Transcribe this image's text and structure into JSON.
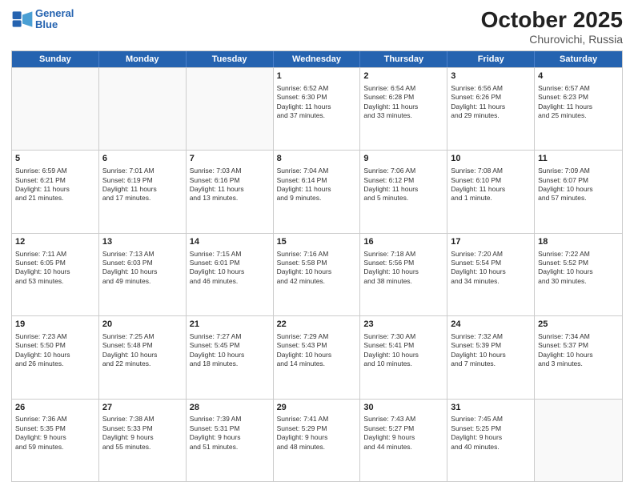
{
  "header": {
    "logo_line1": "General",
    "logo_line2": "Blue",
    "month": "October 2025",
    "location": "Churovichi, Russia"
  },
  "weekdays": [
    "Sunday",
    "Monday",
    "Tuesday",
    "Wednesday",
    "Thursday",
    "Friday",
    "Saturday"
  ],
  "rows": [
    [
      {
        "day": "",
        "text": ""
      },
      {
        "day": "",
        "text": ""
      },
      {
        "day": "",
        "text": ""
      },
      {
        "day": "1",
        "text": "Sunrise: 6:52 AM\nSunset: 6:30 PM\nDaylight: 11 hours\nand 37 minutes."
      },
      {
        "day": "2",
        "text": "Sunrise: 6:54 AM\nSunset: 6:28 PM\nDaylight: 11 hours\nand 33 minutes."
      },
      {
        "day": "3",
        "text": "Sunrise: 6:56 AM\nSunset: 6:26 PM\nDaylight: 11 hours\nand 29 minutes."
      },
      {
        "day": "4",
        "text": "Sunrise: 6:57 AM\nSunset: 6:23 PM\nDaylight: 11 hours\nand 25 minutes."
      }
    ],
    [
      {
        "day": "5",
        "text": "Sunrise: 6:59 AM\nSunset: 6:21 PM\nDaylight: 11 hours\nand 21 minutes."
      },
      {
        "day": "6",
        "text": "Sunrise: 7:01 AM\nSunset: 6:19 PM\nDaylight: 11 hours\nand 17 minutes."
      },
      {
        "day": "7",
        "text": "Sunrise: 7:03 AM\nSunset: 6:16 PM\nDaylight: 11 hours\nand 13 minutes."
      },
      {
        "day": "8",
        "text": "Sunrise: 7:04 AM\nSunset: 6:14 PM\nDaylight: 11 hours\nand 9 minutes."
      },
      {
        "day": "9",
        "text": "Sunrise: 7:06 AM\nSunset: 6:12 PM\nDaylight: 11 hours\nand 5 minutes."
      },
      {
        "day": "10",
        "text": "Sunrise: 7:08 AM\nSunset: 6:10 PM\nDaylight: 11 hours\nand 1 minute."
      },
      {
        "day": "11",
        "text": "Sunrise: 7:09 AM\nSunset: 6:07 PM\nDaylight: 10 hours\nand 57 minutes."
      }
    ],
    [
      {
        "day": "12",
        "text": "Sunrise: 7:11 AM\nSunset: 6:05 PM\nDaylight: 10 hours\nand 53 minutes."
      },
      {
        "day": "13",
        "text": "Sunrise: 7:13 AM\nSunset: 6:03 PM\nDaylight: 10 hours\nand 49 minutes."
      },
      {
        "day": "14",
        "text": "Sunrise: 7:15 AM\nSunset: 6:01 PM\nDaylight: 10 hours\nand 46 minutes."
      },
      {
        "day": "15",
        "text": "Sunrise: 7:16 AM\nSunset: 5:58 PM\nDaylight: 10 hours\nand 42 minutes."
      },
      {
        "day": "16",
        "text": "Sunrise: 7:18 AM\nSunset: 5:56 PM\nDaylight: 10 hours\nand 38 minutes."
      },
      {
        "day": "17",
        "text": "Sunrise: 7:20 AM\nSunset: 5:54 PM\nDaylight: 10 hours\nand 34 minutes."
      },
      {
        "day": "18",
        "text": "Sunrise: 7:22 AM\nSunset: 5:52 PM\nDaylight: 10 hours\nand 30 minutes."
      }
    ],
    [
      {
        "day": "19",
        "text": "Sunrise: 7:23 AM\nSunset: 5:50 PM\nDaylight: 10 hours\nand 26 minutes."
      },
      {
        "day": "20",
        "text": "Sunrise: 7:25 AM\nSunset: 5:48 PM\nDaylight: 10 hours\nand 22 minutes."
      },
      {
        "day": "21",
        "text": "Sunrise: 7:27 AM\nSunset: 5:45 PM\nDaylight: 10 hours\nand 18 minutes."
      },
      {
        "day": "22",
        "text": "Sunrise: 7:29 AM\nSunset: 5:43 PM\nDaylight: 10 hours\nand 14 minutes."
      },
      {
        "day": "23",
        "text": "Sunrise: 7:30 AM\nSunset: 5:41 PM\nDaylight: 10 hours\nand 10 minutes."
      },
      {
        "day": "24",
        "text": "Sunrise: 7:32 AM\nSunset: 5:39 PM\nDaylight: 10 hours\nand 7 minutes."
      },
      {
        "day": "25",
        "text": "Sunrise: 7:34 AM\nSunset: 5:37 PM\nDaylight: 10 hours\nand 3 minutes."
      }
    ],
    [
      {
        "day": "26",
        "text": "Sunrise: 7:36 AM\nSunset: 5:35 PM\nDaylight: 9 hours\nand 59 minutes."
      },
      {
        "day": "27",
        "text": "Sunrise: 7:38 AM\nSunset: 5:33 PM\nDaylight: 9 hours\nand 55 minutes."
      },
      {
        "day": "28",
        "text": "Sunrise: 7:39 AM\nSunset: 5:31 PM\nDaylight: 9 hours\nand 51 minutes."
      },
      {
        "day": "29",
        "text": "Sunrise: 7:41 AM\nSunset: 5:29 PM\nDaylight: 9 hours\nand 48 minutes."
      },
      {
        "day": "30",
        "text": "Sunrise: 7:43 AM\nSunset: 5:27 PM\nDaylight: 9 hours\nand 44 minutes."
      },
      {
        "day": "31",
        "text": "Sunrise: 7:45 AM\nSunset: 5:25 PM\nDaylight: 9 hours\nand 40 minutes."
      },
      {
        "day": "",
        "text": ""
      }
    ]
  ]
}
